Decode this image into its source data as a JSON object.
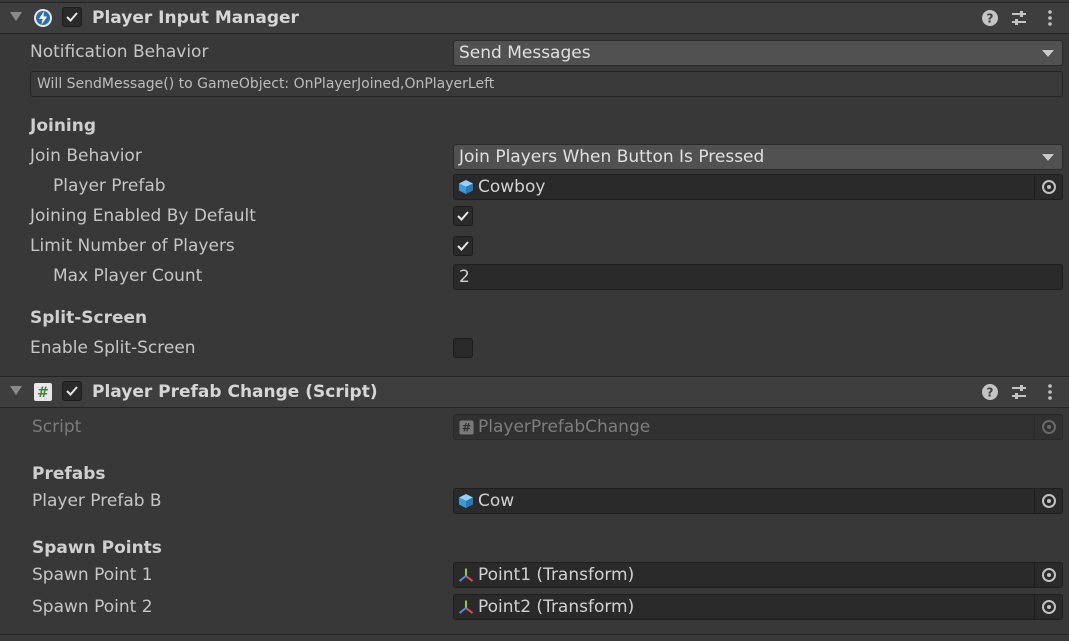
{
  "component1": {
    "title": "Player Input Manager",
    "enabled": true,
    "notification_behavior": {
      "label": "Notification Behavior",
      "value": "Send Messages"
    },
    "help_text": "Will SendMessage() to GameObject: OnPlayerJoined,OnPlayerLeft",
    "joining_header": "Joining",
    "join_behavior": {
      "label": "Join Behavior",
      "value": "Join Players When Button Is Pressed"
    },
    "player_prefab": {
      "label": "Player Prefab",
      "value": "Cowboy",
      "icon": "prefab-cube-icon"
    },
    "joining_enabled": {
      "label": "Joining Enabled By Default",
      "checked": true
    },
    "limit_players": {
      "label": "Limit Number of Players",
      "checked": true
    },
    "max_player_count": {
      "label": "Max Player Count",
      "value": "2"
    },
    "split_screen_header": "Split-Screen",
    "enable_split_screen": {
      "label": "Enable Split-Screen",
      "checked": false
    }
  },
  "component2": {
    "title": "Player Prefab Change (Script)",
    "enabled": true,
    "script": {
      "label": "Script",
      "value": "PlayerPrefabChange"
    },
    "prefabs_header": "Prefabs",
    "player_prefab_b": {
      "label": "Player Prefab B",
      "value": "Cow",
      "icon": "prefab-cube-icon"
    },
    "spawn_points_header": "Spawn Points",
    "spawn_point_1": {
      "label": "Spawn Point 1",
      "value": "Point1 (Transform)",
      "icon": "transform-icon"
    },
    "spawn_point_2": {
      "label": "Spawn Point 2",
      "value": "Point2 (Transform)",
      "icon": "transform-icon"
    }
  },
  "colors": {
    "background": "#383838",
    "header": "#3e3e3e",
    "field": "#2a2a2a",
    "dropdown": "#515151",
    "prefab_blue": "#5fb3e8"
  }
}
